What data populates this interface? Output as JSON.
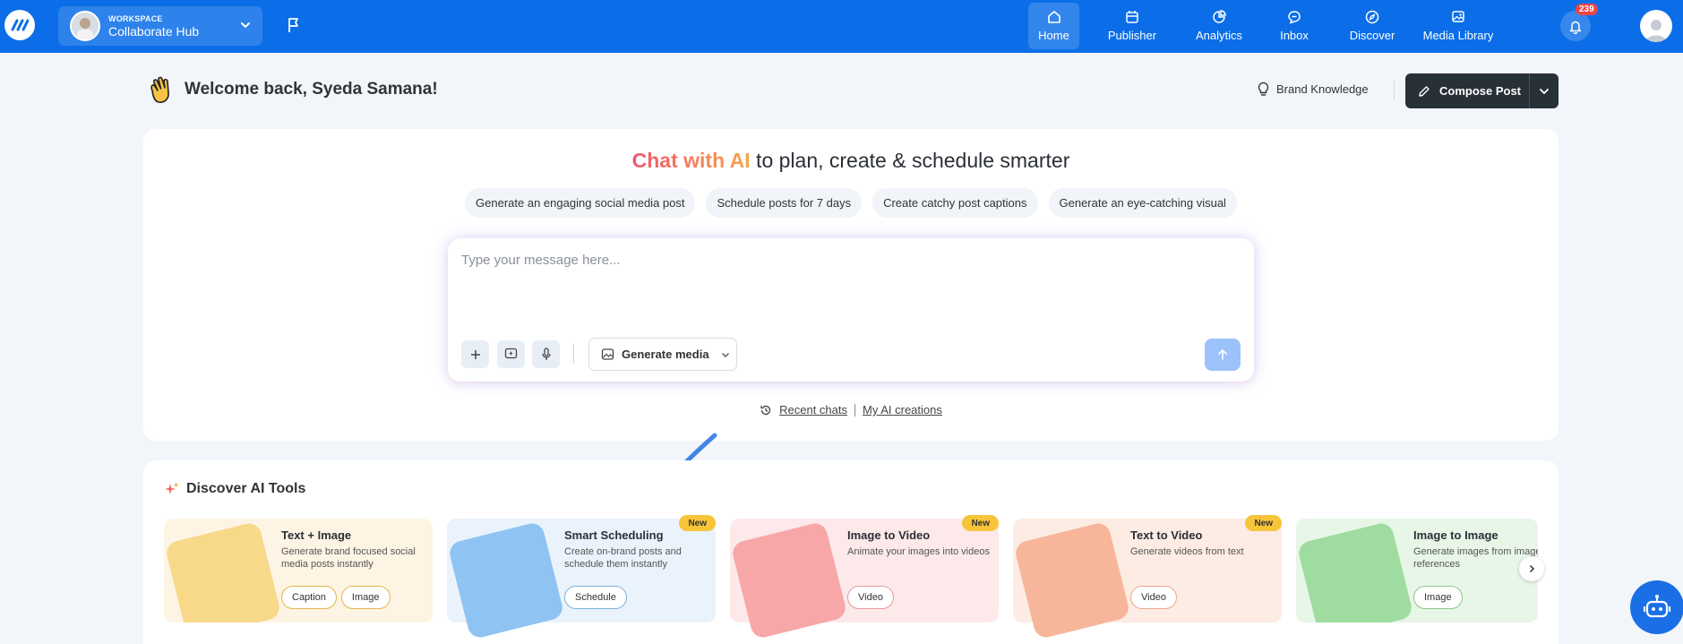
{
  "header": {
    "workspace_label": "WORKSPACE",
    "workspace_name": "Collaborate Hub",
    "nav": [
      {
        "label": "Home",
        "icon": "home-icon",
        "active": true
      },
      {
        "label": "Publisher",
        "icon": "calendar-icon"
      },
      {
        "label": "Analytics",
        "icon": "pie-chart-icon"
      },
      {
        "label": "Inbox",
        "icon": "chat-bubble-icon"
      },
      {
        "label": "Discover",
        "icon": "compass-icon"
      },
      {
        "label": "Media Library",
        "icon": "image-gallery-icon"
      }
    ],
    "notification_count": "239"
  },
  "welcome": {
    "text": "Welcome back, Syeda Samana!",
    "brand_knowledge": "Brand Knowledge",
    "compose_label": "Compose Post"
  },
  "chat": {
    "heading_highlight": "Chat with AI",
    "heading_rest": " to plan, create & schedule smarter",
    "suggestions": [
      "Generate an engaging social media post",
      "Schedule posts for 7 days",
      "Create catchy post captions",
      "Generate an eye-catching visual"
    ],
    "input_placeholder": "Type your message here...",
    "generate_media_label": "Generate media",
    "recent_chats": "Recent chats",
    "my_ai_creations": "My AI creations"
  },
  "discover": {
    "title": "Discover AI Tools",
    "tools": [
      {
        "name": "Text + Image",
        "desc": "Generate brand focused social media posts instantly",
        "tags": [
          "Caption",
          "Image"
        ],
        "is_new": false,
        "bg": "#fdf4e3",
        "tag_color": "#e5b54a",
        "illus": "#f8d98a"
      },
      {
        "name": "Smart Scheduling",
        "desc": "Create on-brand posts and schedule them instantly",
        "tags": [
          "Schedule"
        ],
        "is_new": true,
        "bg": "#eaf3fc",
        "tag_color": "#7fb3de",
        "illus": "#8fc3f2"
      },
      {
        "name": "Image to Video",
        "desc": "Animate your images into videos",
        "tags": [
          "Video"
        ],
        "is_new": true,
        "bg": "#fde9ea",
        "tag_color": "#e99a9a",
        "illus": "#f7a7a7"
      },
      {
        "name": "Text to Video",
        "desc": "Generate videos from text",
        "tags": [
          "Video"
        ],
        "is_new": true,
        "bg": "#fdece3",
        "tag_color": "#eba98a",
        "illus": "#f7b59a"
      },
      {
        "name": "Image to Image",
        "desc": "Generate images from image references",
        "tags": [
          "Image"
        ],
        "is_new": false,
        "bg": "#e8f6e8",
        "tag_color": "#8cc78c",
        "illus": "#9fdc9f"
      }
    ],
    "new_label": "New"
  }
}
